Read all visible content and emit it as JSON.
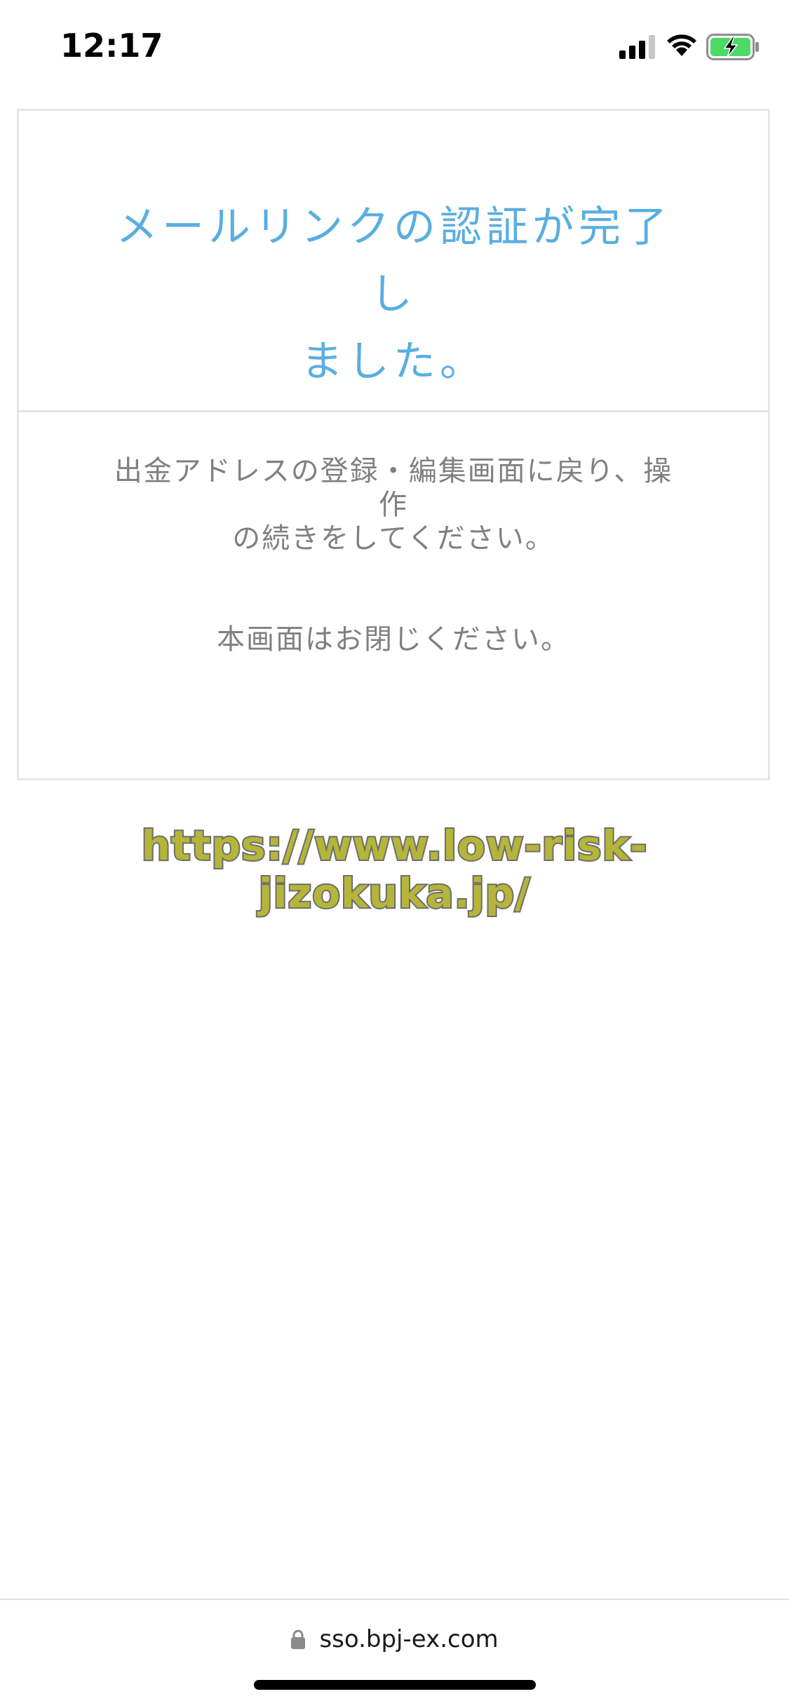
{
  "status_bar": {
    "time": "12:17",
    "icons": [
      "cellular-signal-icon",
      "wifi-icon",
      "battery-charging-icon"
    ],
    "battery_color": "#4cd964"
  },
  "card": {
    "title_line1": "メールリンクの認証が完了し",
    "title_line2": "ました。",
    "body_line1": "出金アドレスの登録・編集画面に戻り、操作",
    "body_line2": "の続きをしてください。",
    "body_line3": "本画面はお閉じください。",
    "title_color": "#5aaee0",
    "text_color": "#808080"
  },
  "watermark": {
    "text": "https://www.low-risk-jizokuka.jp/"
  },
  "browser": {
    "url": "sso.bpj-ex.com",
    "lock_icon": "lock-icon"
  }
}
